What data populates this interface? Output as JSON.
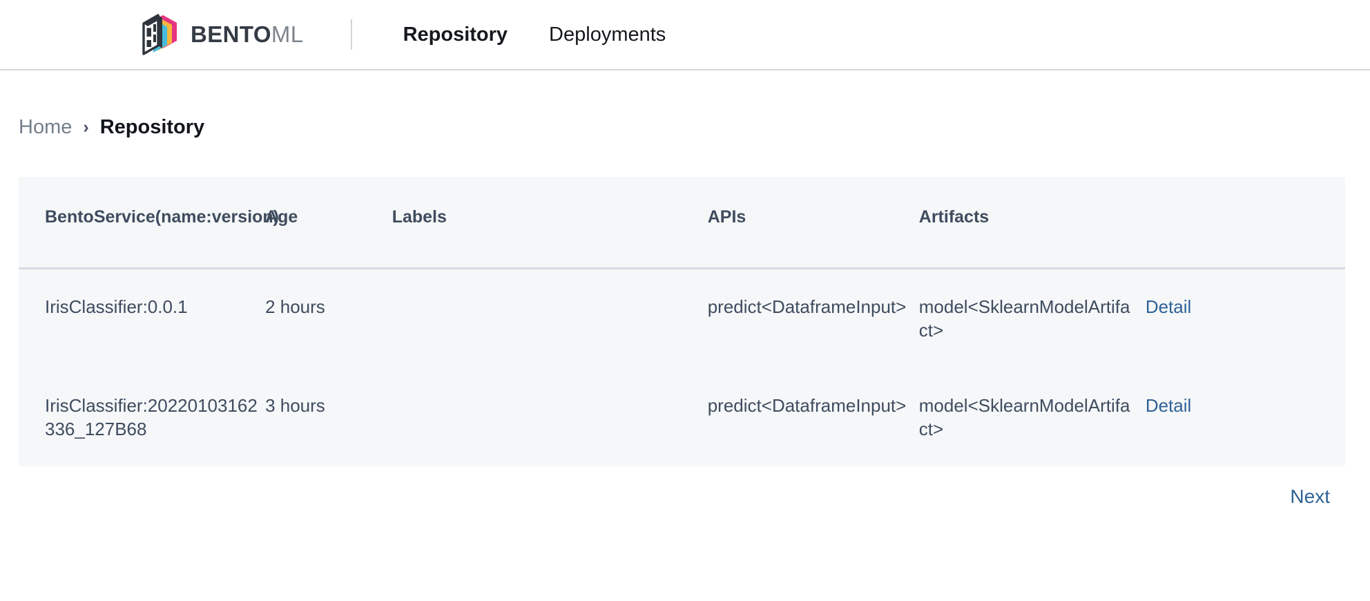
{
  "brand": {
    "name_primary": "BENTO",
    "name_secondary": "ML",
    "logo_icon": "bentoml-box-logo-icon",
    "colors": {
      "magenta": "#e6337f",
      "orange": "#f4b63f",
      "cyan": "#45bcdd",
      "dark": "#343b44"
    }
  },
  "nav": {
    "items": [
      {
        "label": "Repository",
        "active": true
      },
      {
        "label": "Deployments",
        "active": false
      }
    ]
  },
  "breadcrumb": {
    "home_label": "Home",
    "separator": "›",
    "current_label": "Repository"
  },
  "table": {
    "headers": [
      "BentoService(name:version)",
      "Age",
      "Labels",
      "APIs",
      "Artifacts",
      ""
    ],
    "rows": [
      {
        "name": "IrisClassifier:0.0.1",
        "age": "2 hours",
        "labels": "",
        "apis": "predict<DataframeInput>",
        "artifacts": "model<SklearnModelArtifact>",
        "action_label": "Detail"
      },
      {
        "name": "IrisClassifier:20220103162336_127B68",
        "age": "3 hours",
        "labels": "",
        "apis": "predict<DataframeInput>",
        "artifacts": "model<SklearnModelArtifact>",
        "action_label": "Detail"
      }
    ]
  },
  "pagination": {
    "next_label": "Next"
  },
  "theme": {
    "link_color": "#2f6296",
    "table_bg": "#f5f7f9",
    "header_text": "#3f4c5e",
    "muted_text": "#737f8d"
  }
}
